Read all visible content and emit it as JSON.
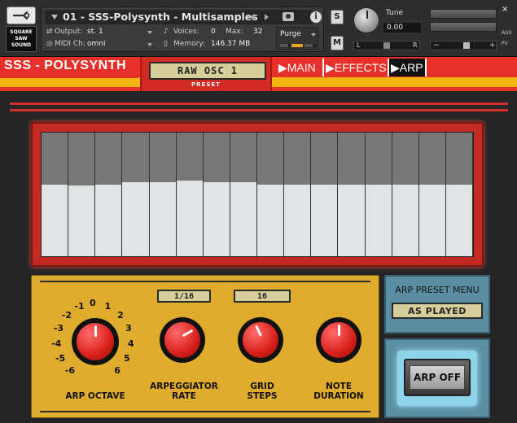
{
  "kontakt": {
    "instrument_name": "01 - SSS-Polysynth - Multisamples",
    "logo_text": "SQUARE\nSAW\nSOUND",
    "output_label": "Output:",
    "output_value": "st. 1",
    "voices_label": "Voices:",
    "voices_value": "0",
    "max_label": "Max:",
    "max_value": "32",
    "midi_label": "MIDI Ch:",
    "midi_value": "omni",
    "memory_label": "Memory:",
    "memory_value": "146.37 MB",
    "purge_label": "Purge",
    "solo_label": "S",
    "mute_label": "M",
    "tune_label": "Tune",
    "tune_value": "0.00",
    "pan_left": "L",
    "pan_right": "R",
    "vol_minus": "−",
    "vol_plus": "+",
    "aux_label": "AUX",
    "pv_label": "PV"
  },
  "instrument": {
    "title": "SSS - POLYSYNTH",
    "preset_value": "RAW OSC 1",
    "preset_caption": "PRESET",
    "tabs": [
      "▶MAIN",
      "▶EFFECTS",
      "▶ARP"
    ],
    "active_tab": 2
  },
  "arp": {
    "step_levels": [
      0.58,
      0.57,
      0.58,
      0.6,
      0.6,
      0.61,
      0.6,
      0.6,
      0.58,
      0.58,
      0.58,
      0.58,
      0.58,
      0.58,
      0.58,
      0.58
    ],
    "octave_labels": [
      "-6",
      "-5",
      "-4",
      "-3",
      "-2",
      "-1",
      "0",
      "1",
      "2",
      "3",
      "4",
      "5",
      "6"
    ],
    "octave_caption": "ARP OCTAVE",
    "rate_value": "1/16",
    "rate_caption_1": "ARPEGGIATOR",
    "rate_caption_2": "RATE",
    "grid_value": "16",
    "grid_caption_1": "GRID",
    "grid_caption_2": "STEPS",
    "note_caption_1": "NOTE",
    "note_caption_2": "DURATION",
    "preset_menu_title": "ARP PRESET MENU",
    "preset_menu_value": "AS PLAYED",
    "arp_button_label": "ARP OFF"
  }
}
